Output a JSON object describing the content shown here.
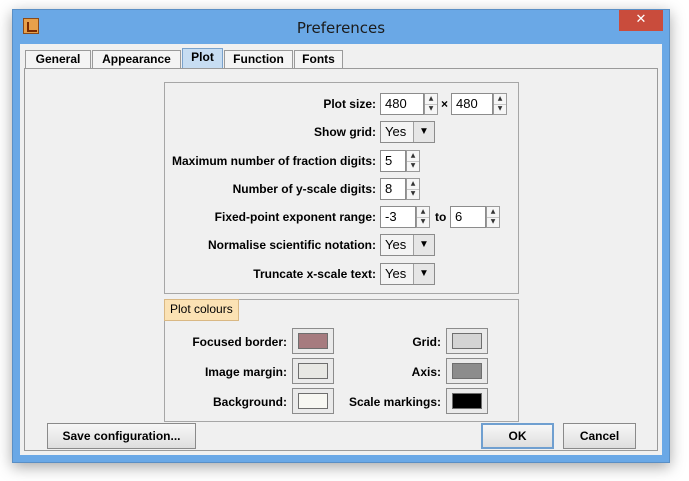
{
  "window": {
    "title": "Preferences",
    "close_glyph": "✕"
  },
  "tabs": [
    {
      "label": "General"
    },
    {
      "label": "Appearance"
    },
    {
      "label": "Plot"
    },
    {
      "label": "Function"
    },
    {
      "label": "Fonts"
    }
  ],
  "active_tab": "Plot",
  "plot": {
    "plot_size": {
      "label": "Plot size:",
      "width": "480",
      "separator": "×",
      "height": "480"
    },
    "show_grid": {
      "label": "Show grid:",
      "value": "Yes"
    },
    "max_fraction_digits": {
      "label": "Maximum number of fraction digits:",
      "value": "5"
    },
    "y_scale_digits": {
      "label": "Number of y-scale digits:",
      "value": "8"
    },
    "exponent_range": {
      "label": "Fixed-point exponent range:",
      "from": "-3",
      "to_label": "to",
      "to": "6"
    },
    "normalise_sci": {
      "label": "Normalise scientific notation:",
      "value": "Yes"
    },
    "truncate_x": {
      "label": "Truncate x-scale text:",
      "value": "Yes"
    }
  },
  "colours": {
    "title": "Plot colours",
    "focused_border": {
      "label": "Focused border:",
      "color": "#a67b7f"
    },
    "image_margin": {
      "label": "Image margin:",
      "color": "#e8e8e4"
    },
    "background": {
      "label": "Background:",
      "color": "#f7f7f2"
    },
    "grid": {
      "label": "Grid:",
      "color": "#d4d4d4"
    },
    "axis": {
      "label": "Axis:",
      "color": "#8c8c8c"
    },
    "scale_markings": {
      "label": "Scale markings:",
      "color": "#000000"
    }
  },
  "buttons": {
    "save": "Save configuration...",
    "ok": "OK",
    "cancel": "Cancel"
  }
}
